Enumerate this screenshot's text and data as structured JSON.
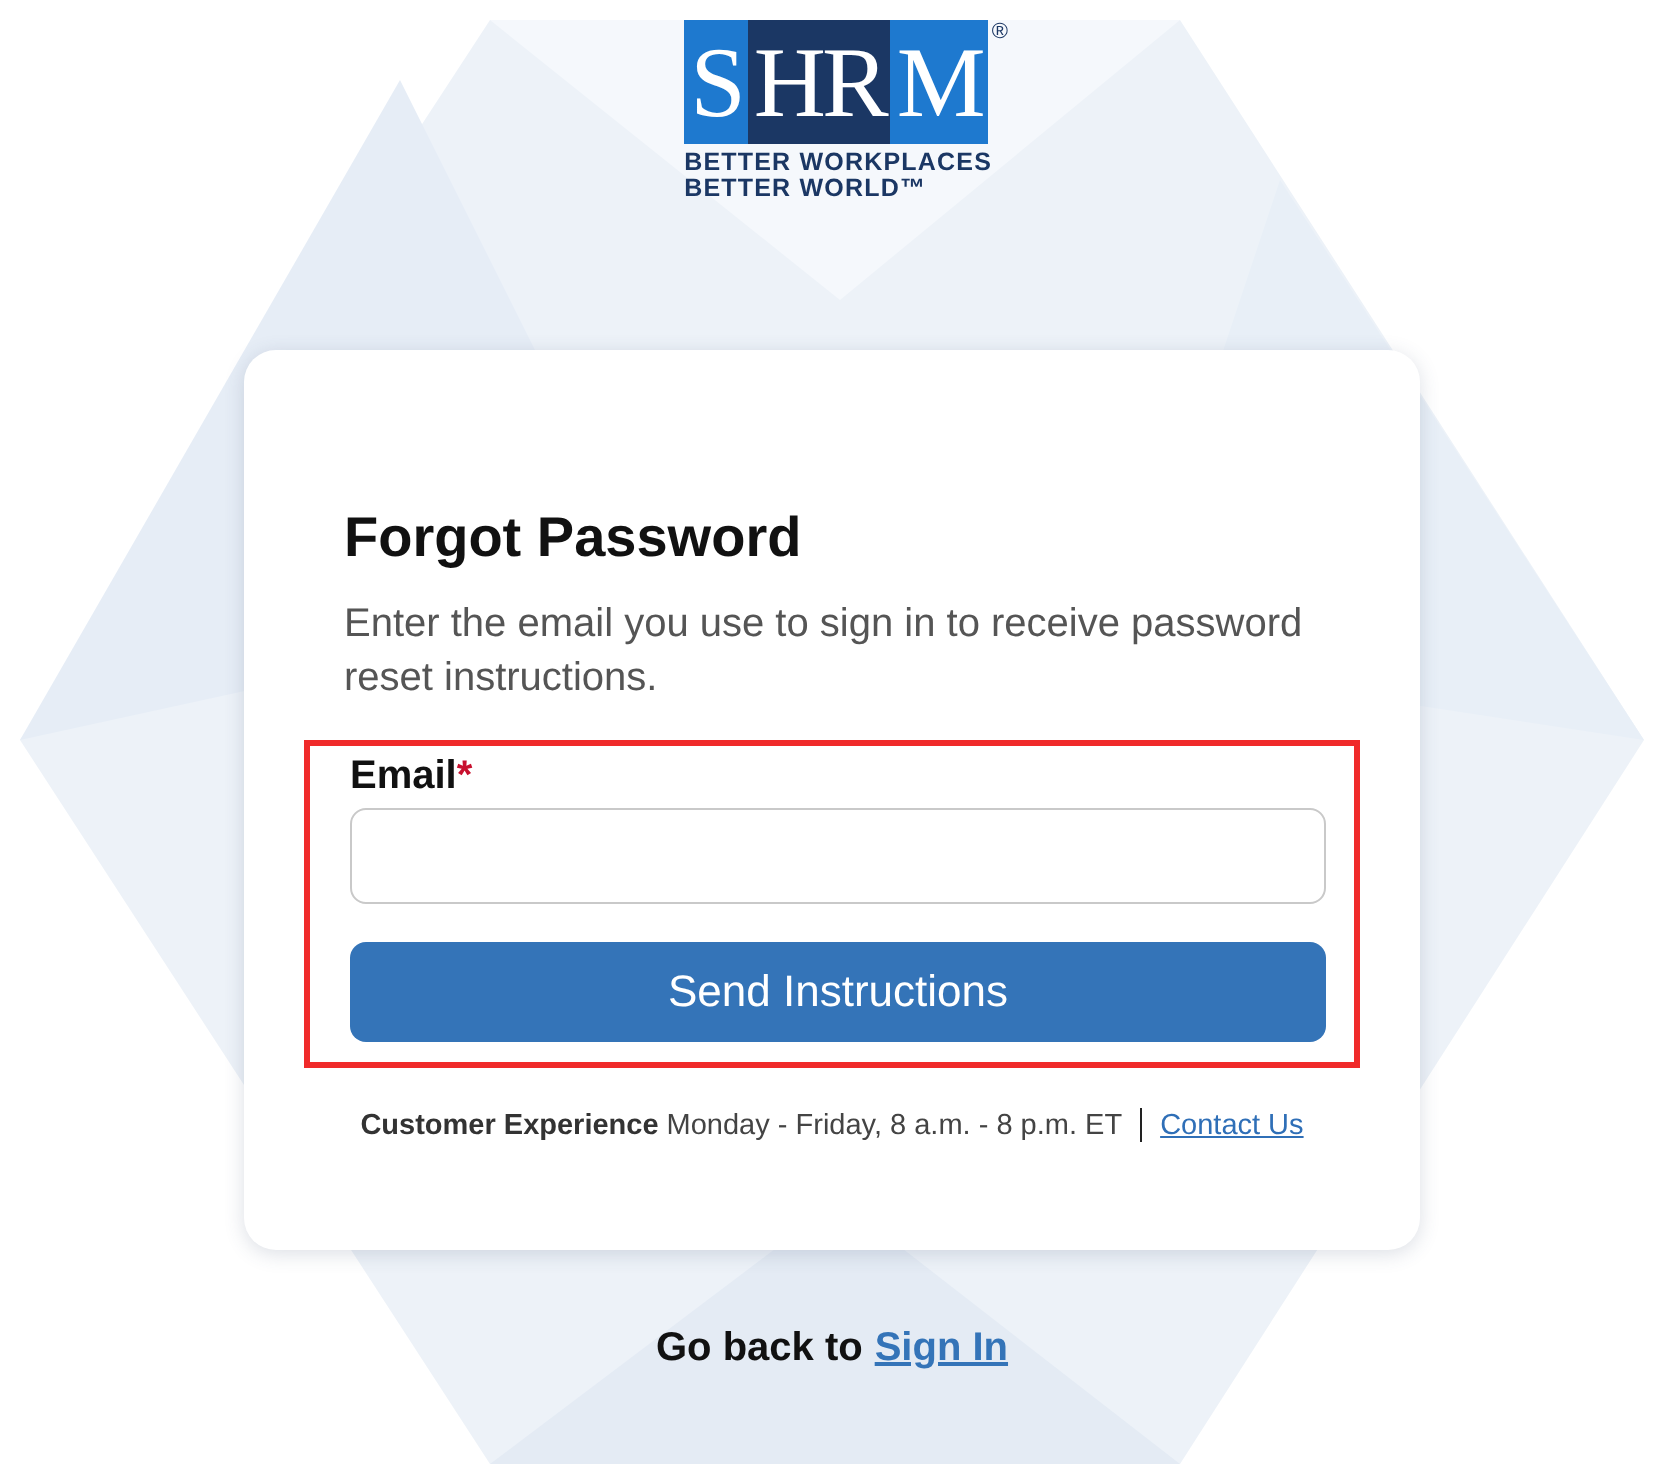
{
  "logo": {
    "segments": [
      {
        "text": "S",
        "kind": "light"
      },
      {
        "text": "HR",
        "kind": "dark"
      },
      {
        "text": "M",
        "kind": "light"
      }
    ],
    "registered": "®",
    "tagline": [
      "BETTER WORKPLACES",
      "BETTER WORLD™"
    ]
  },
  "card": {
    "title": "Forgot Password",
    "description": "Enter the email you use to sign in to receive password reset instructions.",
    "form": {
      "highlighted": true,
      "email": {
        "label": "Email",
        "required_mark": "*"
      },
      "submit": "Send Instructions"
    },
    "support": {
      "label": "Customer Experience",
      "hours": "Monday - Friday, 8 a.m. - 8 p.m. ET",
      "link": "Contact Us"
    }
  },
  "footer": {
    "text": "Go back to",
    "link": "Sign In"
  }
}
